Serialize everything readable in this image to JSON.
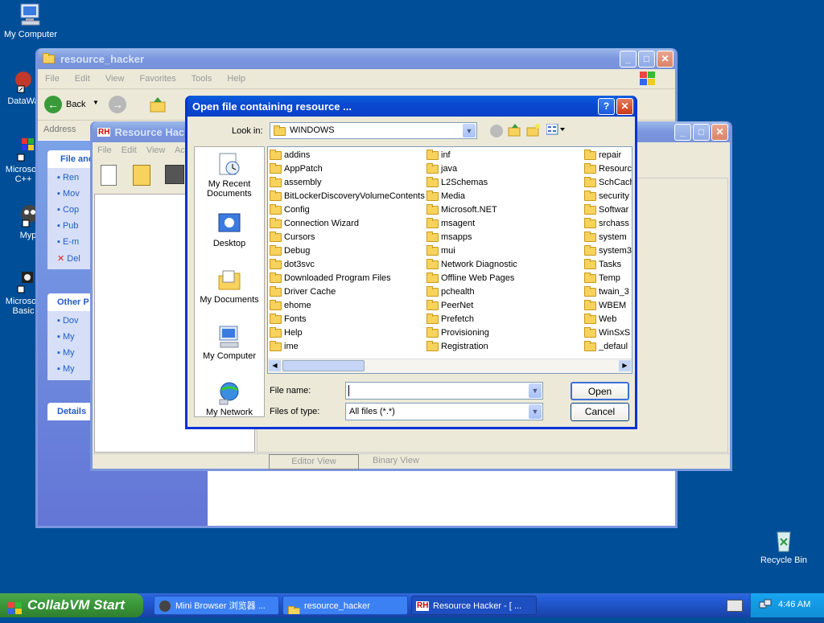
{
  "desktop": {
    "icons": [
      {
        "label": "My Computer",
        "icon": "my-computer-icon"
      },
      {
        "label": "DataWa",
        "icon": "datawa-shortcut-icon"
      },
      {
        "label": "Microsoft C++",
        "icon": "microsoft-cpp-icon"
      },
      {
        "label": "Myp",
        "icon": "myp-shortcut-icon"
      },
      {
        "label": "Microsoft Basic",
        "icon": "microsoft-basic-icon"
      },
      {
        "label": "Recycle Bin",
        "icon": "recycle-bin-icon"
      }
    ]
  },
  "explorer": {
    "title": "resource_hacker",
    "menu": [
      "File",
      "Edit",
      "View",
      "Favorites",
      "Tools",
      "Help"
    ],
    "back_label": "Back",
    "address_label": "Address",
    "panel_file_title": "File and",
    "panel_file_items": [
      "Ren",
      "Mov",
      "Cop",
      "Pub",
      "E-m",
      "Del"
    ],
    "panel_other_title": "Other P",
    "panel_other_items": [
      "Dov",
      "My",
      "My",
      "My"
    ],
    "panel_details_title": "Details"
  },
  "rh": {
    "title": "Resource Hacke",
    "menu": [
      "File",
      "Edit",
      "View",
      "Act"
    ],
    "tab_editor": "Editor View",
    "tab_binary": "Binary View"
  },
  "dialog": {
    "title": "Open file containing resource ...",
    "look_in_label": "Look in:",
    "look_in_value": "WINDOWS",
    "places": [
      "My Recent Documents",
      "Desktop",
      "My Documents",
      "My Computer",
      "My Network"
    ],
    "columns": [
      [
        "addins",
        "AppPatch",
        "assembly",
        "BitLockerDiscoveryVolumeContents",
        "Config",
        "Connection Wizard",
        "Cursors",
        "Debug",
        "dot3svc",
        "Downloaded Program Files",
        "Driver Cache",
        "ehome",
        "Fonts",
        "Help",
        "ime"
      ],
      [
        "inf",
        "java",
        "L2Schemas",
        "Media",
        "Microsoft.NET",
        "msagent",
        "msapps",
        "mui",
        "Network Diagnostic",
        "Offline Web Pages",
        "pchealth",
        "PeerNet",
        "Prefetch",
        "Provisioning",
        "Registration"
      ],
      [
        "repair",
        "Resourc",
        "SchCach",
        "security",
        "Softwar",
        "srchass",
        "system",
        "system3",
        "Tasks",
        "Temp",
        "twain_3",
        "WBEM",
        "Web",
        "WinSxS",
        "_defaul"
      ]
    ],
    "file_name_label": "File name:",
    "file_name_value": "",
    "files_of_type_label": "Files of type:",
    "files_of_type_value": "All files (*.*)",
    "open_label": "Open",
    "cancel_label": "Cancel",
    "help_label": "?"
  },
  "taskbar": {
    "start_label": "CollabVM Start",
    "items": [
      "Mini Browser 浏览器 ...",
      "resource_hacker",
      "Resource Hacker - [ ..."
    ],
    "clock": "4:46 AM"
  },
  "colors": {
    "desktop": "#004e98",
    "title_active": "#0a4ad0",
    "taskbar": "#245edb",
    "start": "#3c9a3c"
  }
}
